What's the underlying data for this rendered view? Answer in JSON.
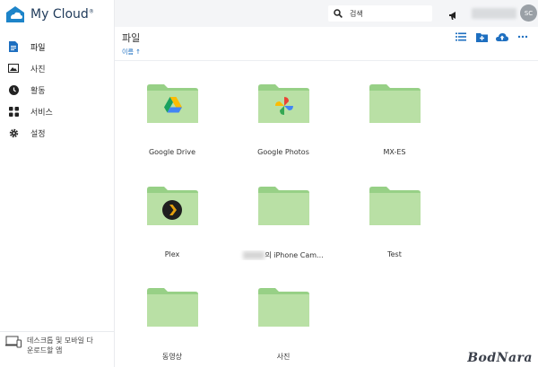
{
  "app": {
    "name": "My Cloud",
    "trademark": "®"
  },
  "sidebar": {
    "items": [
      {
        "label": "파일",
        "icon": "file-icon",
        "active": true
      },
      {
        "label": "사진",
        "icon": "photo-icon",
        "active": false
      },
      {
        "label": "활동",
        "icon": "clock-icon",
        "active": false
      },
      {
        "label": "서비스",
        "icon": "grid-icon",
        "active": false
      },
      {
        "label": "설정",
        "icon": "gear-icon",
        "active": false
      }
    ],
    "footer_label": "데스크톱 및 모바일 다운로드할 앱"
  },
  "topbar": {
    "search_label": "검색",
    "avatar_initials": "SC"
  },
  "main": {
    "title": "파일",
    "sort_label": "이름 ↑",
    "folders": [
      {
        "name": "Google Drive",
        "badge": "google-drive-icon"
      },
      {
        "name": "Google Photos",
        "badge": "google-photos-icon"
      },
      {
        "name": "MX-ES",
        "badge": ""
      },
      {
        "name": "Plex",
        "badge": "plex-icon"
      },
      {
        "name": "의 iPhone Cam...",
        "badge": ""
      },
      {
        "name": "Test",
        "badge": ""
      },
      {
        "name": "동영상",
        "badge": ""
      },
      {
        "name": "사진",
        "badge": ""
      }
    ]
  },
  "colors": {
    "accent": "#1e6fc0",
    "folder": "#b9e0a5",
    "folder_tab": "#97d086"
  },
  "watermark": "BodNara"
}
